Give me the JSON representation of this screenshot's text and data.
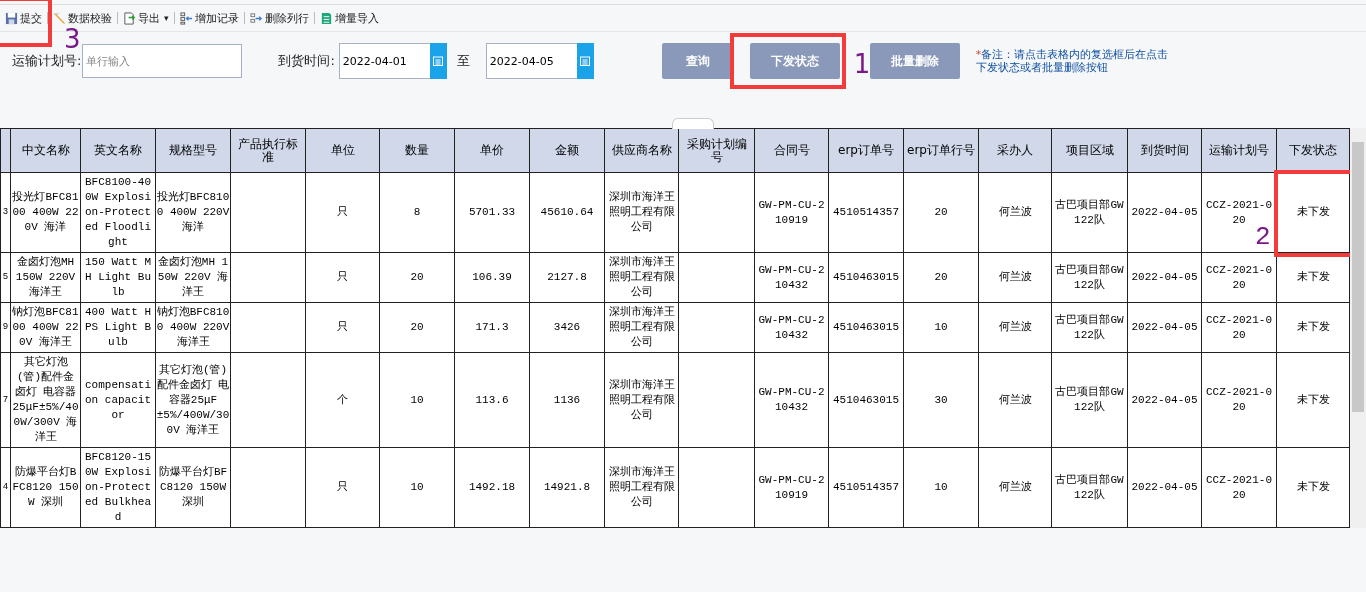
{
  "toolbar": [
    {
      "label": "提交",
      "kind": "save",
      "callout": "3"
    },
    {
      "label": "数据校验",
      "kind": "check"
    },
    {
      "label": "导出",
      "kind": "export",
      "caret": "▾"
    },
    {
      "label": "增加记录",
      "kind": "add"
    },
    {
      "label": "删除列行",
      "kind": "delete"
    },
    {
      "label": "增量导入",
      "kind": "import"
    }
  ],
  "filters": {
    "plan_label": "运输计划号:",
    "plan_placeholder": "单行输入",
    "date_label": "到货时间:",
    "date_from": "2022-04-01",
    "date_sep": "至",
    "date_to": "2022-04-05"
  },
  "buttons": [
    {
      "label": "查询",
      "disabled": true
    },
    {
      "label": "下发状态",
      "disabled": true,
      "callout": "1"
    },
    {
      "label": "批量删除",
      "disabled": true
    }
  ],
  "note": {
    "marker": "*",
    "text": "备注：请点击表格内的复选框后在点击下发状态或者批量删除按钮"
  },
  "table": {
    "columns": [
      "",
      "中文名称",
      "英文名称",
      "规格型号",
      "产品执行标准",
      "单位",
      "数量",
      "单价",
      "金额",
      "供应商名称",
      "采购计划编号",
      "合同号",
      "erp订单号",
      "erp订单行号",
      "采办人",
      "项目区域",
      "到货时间",
      "运输计划号",
      "下发状态"
    ],
    "rows": [
      {
        "cells": [
          "3",
          "投光灯BFC8100 400W 220V 海洋",
          "BFC8100-400W Explosion-Protected Floodlight",
          "投光灯BFC8100 400W 220V 海洋",
          "",
          "只",
          "8",
          "5701.33",
          "45610.64",
          "深圳市海洋王照明工程有限公司",
          "",
          "GW-PM-CU-210919",
          "4510514357",
          "20",
          "何兰波",
          "古巴项目部GW122队",
          "2022-04-05",
          "CCZ-2021-020",
          "未下发"
        ],
        "callout": "2"
      },
      {
        "cells": [
          "5",
          "金卤灯泡MH 150W 220V 海洋王",
          "150 Watt MH Light Bulb",
          "金卤灯泡MH 150W 220V 海洋王",
          "",
          "只",
          "20",
          "106.39",
          "2127.8",
          "深圳市海洋王照明工程有限公司",
          "",
          "GW-PM-CU-210432",
          "4510463015",
          "20",
          "何兰波",
          "古巴项目部GW122队",
          "2022-04-05",
          "CCZ-2021-020",
          "未下发"
        ]
      },
      {
        "cells": [
          "9",
          "钠灯泡BFC8100 400W 220V 海洋王",
          "400 Watt HPS Light Bulb",
          "钠灯泡BFC8100 400W 220V 海洋王",
          "",
          "只",
          "20",
          "171.3",
          "3426",
          "深圳市海洋王照明工程有限公司",
          "",
          "GW-PM-CU-210432",
          "4510463015",
          "10",
          "何兰波",
          "古巴项目部GW122队",
          "2022-04-05",
          "CCZ-2021-020",
          "未下发"
        ]
      },
      {
        "cells": [
          "7",
          "其它灯泡(管)配件金卤灯 电容器25μF±5%/400W/300V 海洋王",
          "compensation capacitor",
          "其它灯泡(管)配件金卤灯 电容器25μF±5%/400W/300V 海洋王",
          "",
          "个",
          "10",
          "113.6",
          "1136",
          "深圳市海洋王照明工程有限公司",
          "",
          "GW-PM-CU-210432",
          "4510463015",
          "30",
          "何兰波",
          "古巴项目部GW122队",
          "2022-04-05",
          "CCZ-2021-020",
          "未下发"
        ]
      },
      {
        "cells": [
          "4",
          "防爆平台灯BFC8120 150W 深圳",
          "BFC8120-150W Explosion-Protected Bulkhead",
          "防爆平台灯BFC8120 150W 深圳",
          "",
          "只",
          "10",
          "1492.18",
          "14921.8",
          "深圳市海洋王照明工程有限公司",
          "",
          "GW-PM-CU-210919",
          "4510514357",
          "10",
          "何兰波",
          "古巴项目部GW122队",
          "2022-04-05",
          "CCZ-2021-020",
          "未下发"
        ]
      }
    ]
  }
}
